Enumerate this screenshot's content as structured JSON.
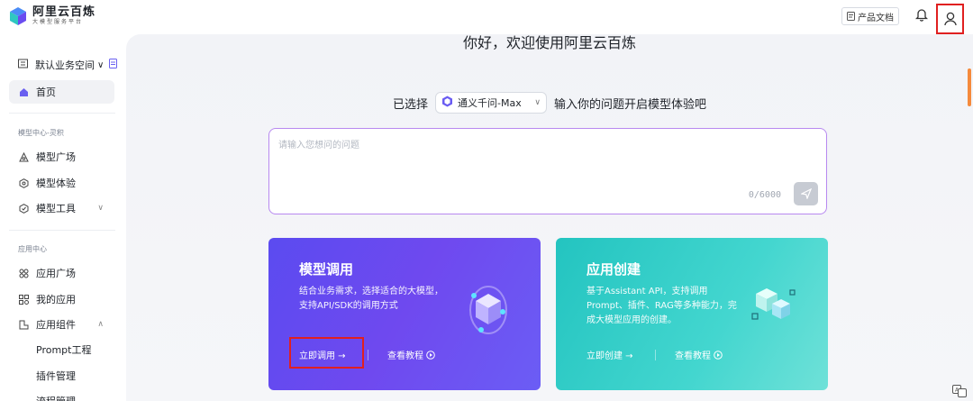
{
  "header": {
    "logo_title": "阿里云百炼",
    "logo_subtitle": "大模型服务平台",
    "doc_button": "产品文档",
    "bell_icon": "bell-icon",
    "user_icon": "user-icon"
  },
  "sidebar": {
    "workspace": "默认业务空间",
    "home": "首页",
    "group_model": "模型中心-灵积",
    "model_square": "模型广场",
    "model_experience": "模型体验",
    "model_tools": "模型工具",
    "group_app": "应用中心",
    "app_square": "应用广场",
    "my_apps": "我的应用",
    "app_components": "应用组件",
    "prompt_eng": "Prompt工程",
    "plugin_mgmt": "插件管理",
    "flow_mgmt": "流程管理"
  },
  "main": {
    "welcome": "你好，欢迎使用阿里云百炼",
    "selected_prefix": "已选择",
    "selected_model": "通义千问-Max",
    "selected_suffix": "输入你的问题开启模型体验吧",
    "input_placeholder": "请输入您想问的问题",
    "counter": "0/6000"
  },
  "cards": {
    "invoke": {
      "title": "模型调用",
      "desc": "结合业务需求，选择适合的大模型，支持API/SDK的调用方式",
      "primary": "立即调用 →",
      "secondary": "查看教程"
    },
    "create": {
      "title": "应用创建",
      "desc": "基于Assistant API，支持调用Prompt、插件、RAG等多种能力，完成大模型应用的创建。",
      "primary": "立即创建 →",
      "secondary": "查看教程"
    }
  },
  "colors": {
    "purple_card": "#6349ef",
    "teal_card": "#2ccac4",
    "highlight": "#e02020",
    "input_border": "#b889f0"
  }
}
